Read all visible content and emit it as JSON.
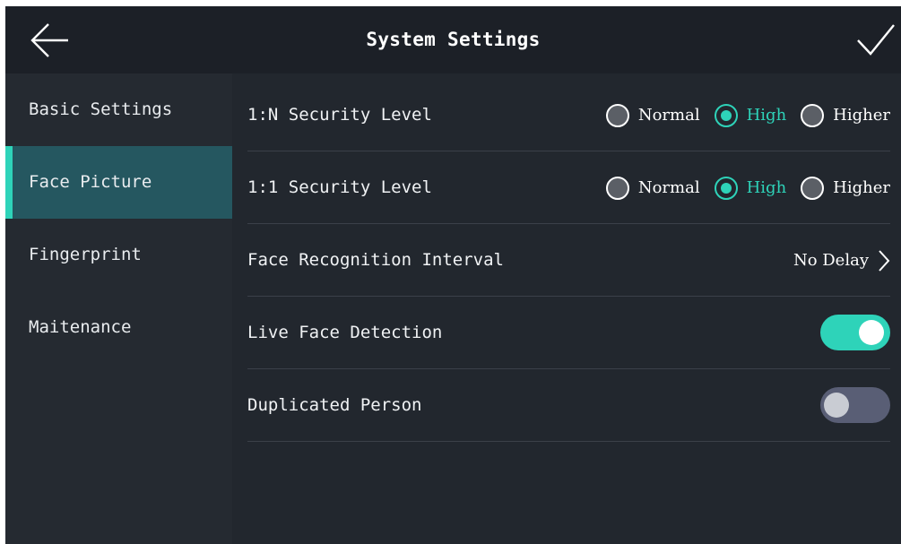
{
  "header": {
    "title": "System Settings",
    "back_icon": "arrow-left-icon",
    "confirm_icon": "checkmark-icon"
  },
  "sidebar": {
    "items": [
      {
        "label": "Basic Settings",
        "active": false
      },
      {
        "label": "Face Picture",
        "active": true
      },
      {
        "label": "Fingerprint",
        "active": false
      },
      {
        "label": "Maitenance",
        "active": false
      }
    ]
  },
  "settings": {
    "n_security": {
      "label": "1:N Security Level",
      "options": [
        "Normal",
        "High",
        "Higher"
      ],
      "selected": "High"
    },
    "one_security": {
      "label": "1:1 Security Level",
      "options": [
        "Normal",
        "High",
        "Higher"
      ],
      "selected": "High"
    },
    "recognition_interval": {
      "label": "Face Recognition Interval",
      "value": "No Delay"
    },
    "live_detection": {
      "label": "Live Face Detection",
      "enabled": true
    },
    "duplicated_person": {
      "label": "Duplicated Person",
      "enabled": false
    }
  },
  "colors": {
    "accent": "#2ed3b9",
    "background": "#22272e",
    "header": "#1c2027",
    "active_item": "#255760",
    "toggle_off": "#595e75"
  }
}
